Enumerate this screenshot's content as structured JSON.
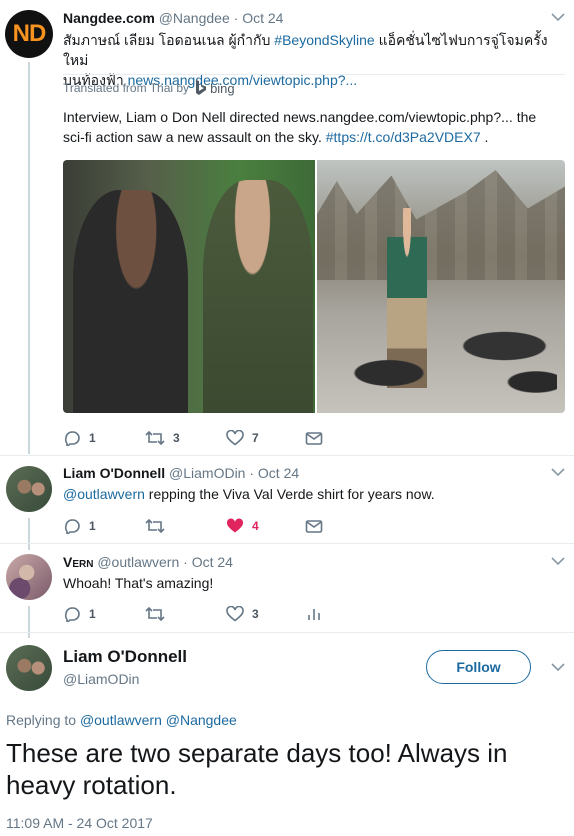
{
  "tweet1": {
    "avatar_text": "ND",
    "name": "Nangdee.com",
    "handle": "@Nangdee",
    "date": "· Oct 24",
    "text_main": "สัมภาษณ์ เลียม โอดอนเนล ผู้กำกับ ",
    "hashtag": "#BeyondSkyline",
    "text_cont": " แอ็คชั่นไซไฟบการจู่โจมครั้งใหม่",
    "text_line2": "บนท้องฟ้า ",
    "link": "news.nangdee.com/viewtopic.php?...",
    "translated_label": "Translated from Thai by",
    "translator": "bing",
    "translation_part1": "Interview, Liam o Don Nell directed news.nangdee.com/viewtopic.php?... the",
    "translation_part2": "sci-fi action saw a new assault on the sky. ",
    "translation_link": "#ttps://t.co/d3Pa2VDEX7",
    "translation_end": " .",
    "replies": "1",
    "retweets": "3",
    "likes": "7"
  },
  "tweet2": {
    "name": "Liam O'Donnell",
    "handle": "@LiamODin",
    "date": "· Oct 24",
    "mention": "@outlawvern",
    "text": " repping the Viva Val Verde shirt for years now.",
    "replies": "1",
    "retweets": "",
    "likes": "4"
  },
  "tweet3": {
    "name": "Vern",
    "handle": "@outlawvern",
    "date": "· Oct 24",
    "text": "Whoah! That's amazing!",
    "replies": "1",
    "retweets": "",
    "likes": "3"
  },
  "main_tweet": {
    "name": "Liam O'Donnell",
    "handle": "@LiamODin",
    "follow_label": "Follow",
    "replying_to_label": "Replying to",
    "replying_to_1": "@outlawvern",
    "replying_to_2": "@Nangdee",
    "text": "These are two separate days too! Always in heavy rotation.",
    "timestamp": "11:09 AM - 24 Oct 2017"
  },
  "colors": {
    "link": "#1c6aa0",
    "muted": "#657786",
    "like_active": "#e0245e",
    "thread_line": "#ccd6dd"
  }
}
